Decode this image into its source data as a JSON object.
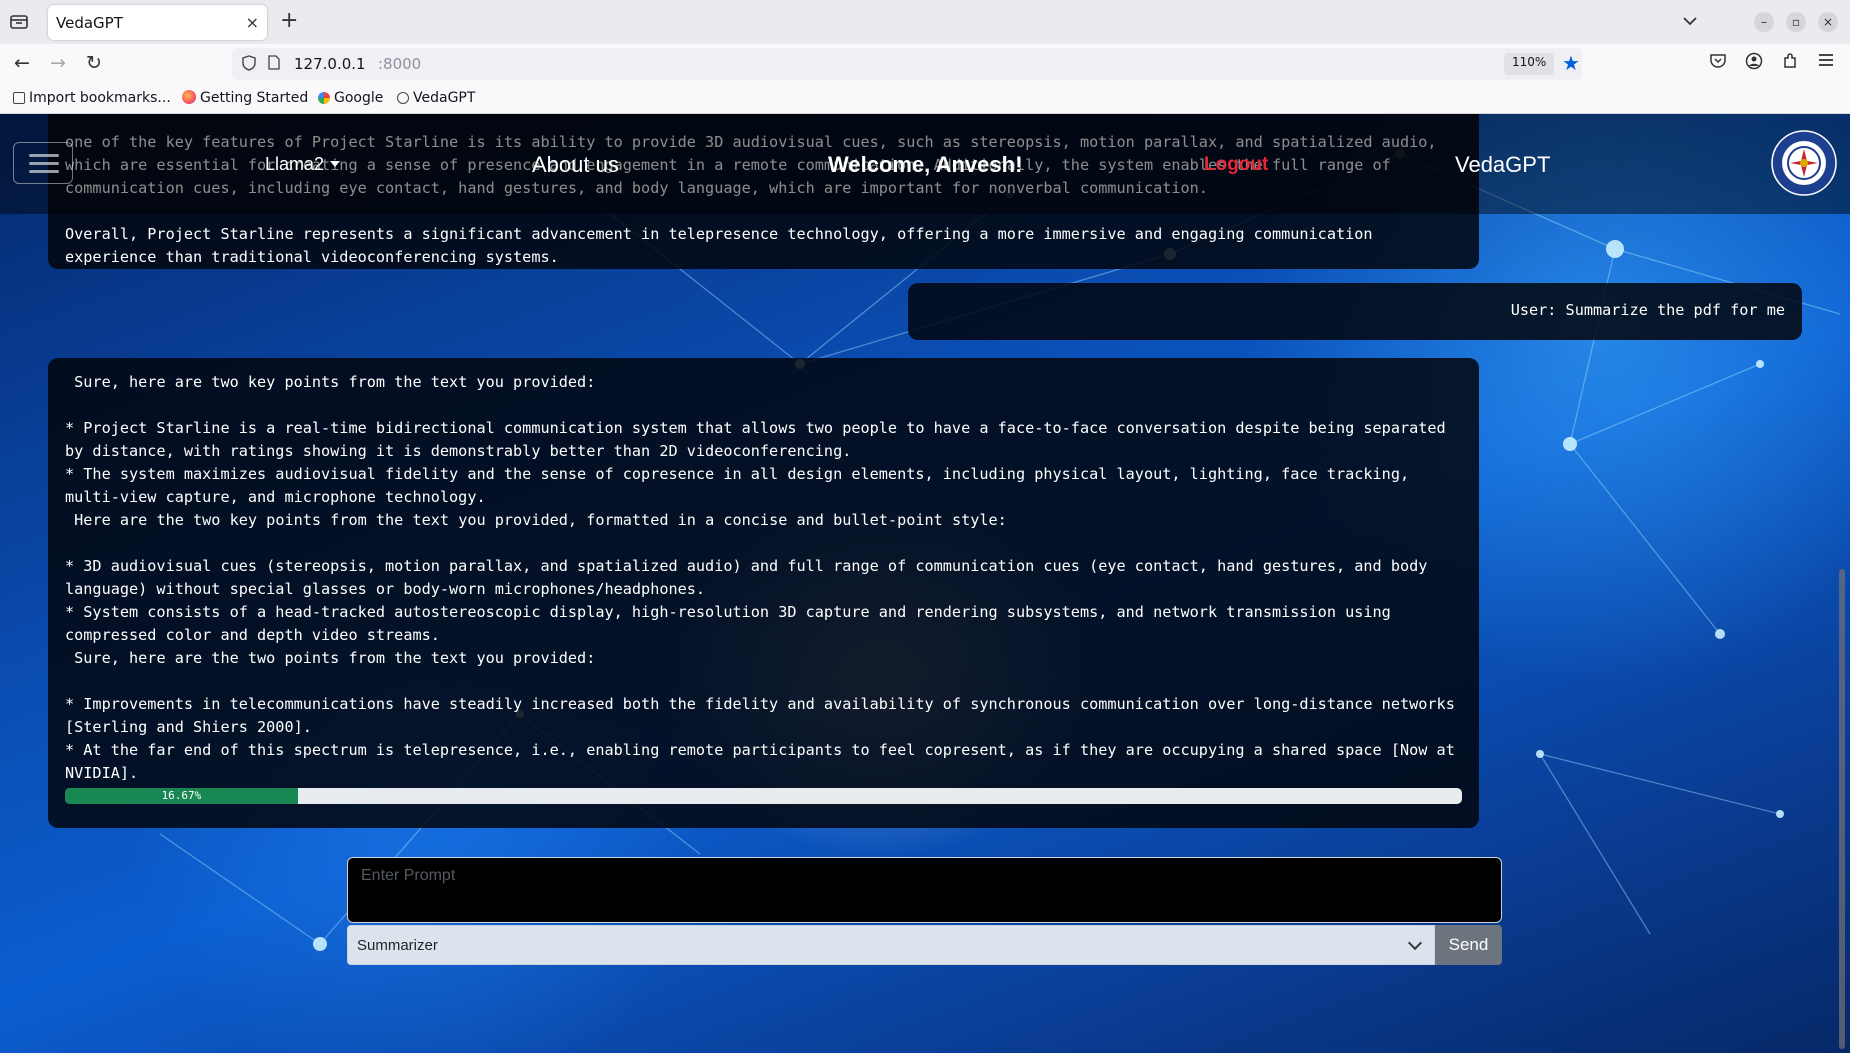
{
  "browser": {
    "tab_title": "VedaGPT",
    "tab_close": "×",
    "new_tab": "+",
    "url_host": "127.0.0.1",
    "url_port": ":8000",
    "zoom": "110%",
    "bookmarks": [
      {
        "label": "Import bookmarks..."
      },
      {
        "label": "Getting Started"
      },
      {
        "label": "Google"
      },
      {
        "label": "VedaGPT"
      }
    ]
  },
  "header": {
    "model_label": "Llama2",
    "about_label": "About us",
    "welcome_text": "Welcome, Anvesh!",
    "logout_label": "Logout",
    "brand": "VedaGPT"
  },
  "chat": {
    "previous_reply": "one of the key features of Project Starline is its ability to provide 3D audiovisual cues, such as stereopsis, motion parallax, and spatialized audio,\nwhich are essential for creating a sense of presence and engagement in a remote communication. Additionally, the system enables the full range of\ncommunication cues, including eye contact, hand gestures, and body language, which are important for nonverbal communication.\n\nOverall, Project Starline represents a significant advancement in telepresence technology, offering a more immersive and engaging communication\nexperience than traditional videoconferencing systems.",
    "user_message": "User: Summarize the pdf for me",
    "assistant_reply": " Sure, here are two key points from the text you provided:\n\n* Project Starline is a real-time bidirectional communication system that allows two people to have a face-to-face conversation despite being separated\nby distance, with ratings showing it is demonstrably better than 2D videoconferencing.\n* The system maximizes audiovisual fidelity and the sense of copresence in all design elements, including physical layout, lighting, face tracking,\nmulti-view capture, and microphone technology.\n Here are the two key points from the text you provided, formatted in a concise and bullet-point style:\n\n* 3D audiovisual cues (stereopsis, motion parallax, and spatialized audio) and full range of communication cues (eye contact, hand gestures, and body\nlanguage) without special glasses or body-worn microphones/headphones.\n* System consists of a head-tracked autostereoscopic display, high-resolution 3D capture and rendering subsystems, and network transmission using\ncompressed color and depth video streams.\n Sure, here are the two points from the text you provided:\n\n* Improvements in telecommunications have steadily increased both the fidelity and availability of synchronous communication over long-distance networks\n[Sterling and Shiers 2000].\n* At the far end of this spectrum is telepresence, i.e., enabling remote participants to feel copresent, as if they are occupying a shared space [Now at\nNVIDIA].",
    "progress_text": "16.67%",
    "progress_value": 16.67
  },
  "input": {
    "placeholder": "Enter Prompt",
    "value": "",
    "mode_selected": "Summarizer",
    "send_label": "Send"
  },
  "colors": {
    "accent_logout": "#e4283a",
    "progress_fill": "#198754",
    "star_accent": "#0061e0"
  },
  "icons": [
    "tab-list-icon",
    "close-icon",
    "plus-icon",
    "chevron-down-icon",
    "back-icon",
    "forward-icon",
    "reload-icon",
    "shield-icon",
    "page-icon",
    "star-icon",
    "pocket-icon",
    "account-icon",
    "extensions-icon",
    "menu-icon",
    "hamburger-icon",
    "drdo-logo"
  ]
}
